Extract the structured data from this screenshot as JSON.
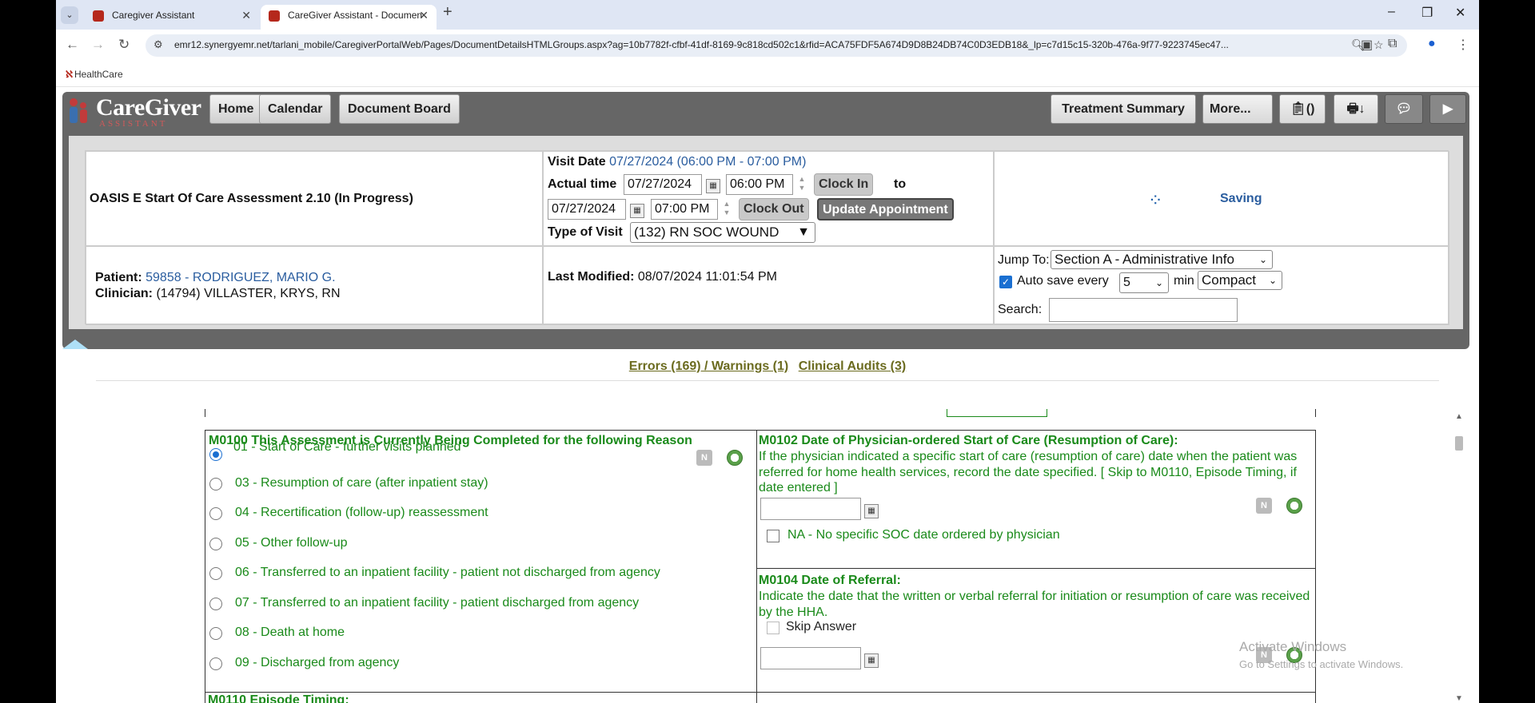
{
  "browser": {
    "tabs": [
      {
        "title": "Caregiver Assistant"
      },
      {
        "title": "CareGiver Assistant - Documen"
      }
    ],
    "url": "emr12.synergyemr.net/tarlani_mobile/CaregiverPortalWeb/Pages/DocumentDetailsHTMLGroups.aspx?ag=10b7782f-cfbf-41df-8169-9c818cd502c1&rfid=ACA75FDF5A674D9D8B24DB74C0D3EDB18&_lp=c7d15c15-320b-476a-9f77-9223745ec47...",
    "bookmark": "HealthCare"
  },
  "app": {
    "logo_main": "CareGiver",
    "logo_sub": "ASSISTANT",
    "nav": [
      "Home",
      "Calendar",
      "Document Board"
    ],
    "right_buttons": [
      "Treatment Summary",
      "More..."
    ],
    "clipboard_badge": "()"
  },
  "header": {
    "doc_title": "OASIS E Start Of Care Assessment 2.10 (In Progress)",
    "visit_date_label": "Visit Date",
    "visit_date_value": "07/27/2024 (06:00 PM - 07:00 PM)",
    "actual_time_label": "Actual time",
    "start_date": "07/27/2024",
    "start_time": "06:00 PM",
    "clock_in": "Clock In",
    "to_label": "to",
    "end_date": "07/27/2024",
    "end_time": "07:00 PM",
    "clock_out": "Clock Out",
    "update_appt": "Update Appointment",
    "type_label": "Type of Visit",
    "type_value": "(132) RN SOC WOUND",
    "saving": "Saving",
    "patient_label": "Patient:",
    "patient_value": "59858 - RODRIGUEZ, MARIO G.",
    "clinician_label": "Clinician:",
    "clinician_value": "(14794) VILLASTER, KRYS, RN",
    "last_mod_label": "Last Modified:",
    "last_mod_value": "08/07/2024 11:01:54 PM",
    "jump_label": "Jump To:",
    "jump_value": "Section A - Administrative Info",
    "autosave_label": "Auto save every",
    "autosave_value": "5",
    "min_label": "min",
    "view_value": "Compact",
    "search_label": "Search:"
  },
  "audits": {
    "errors": "Errors (169) / Warnings (1)",
    "clinical": "Clinical Audits (3)"
  },
  "form": {
    "m0100_title": "M0100 This Assessment is Currently Being Completed for the following Reason",
    "m0100_options": [
      "01 - Start of Care - further visits planned",
      "03 - Resumption of care (after inpatient stay)",
      "04 - Recertification (follow-up) reassessment",
      "05 - Other follow-up",
      "06 - Transferred to an inpatient facility - patient not discharged from agency",
      "07 - Transferred to an inpatient facility - patient discharged from agency",
      "08 - Death at home",
      "09 - Discharged from agency"
    ],
    "m0100_selected": 0,
    "m0102_title": "M0102 Date of Physician-ordered Start of Care (Resumption of Care):",
    "m0102_text": "If the physician indicated a specific start of care (resumption of care) date when the patient was referred for home health services, record the date specified. [ Skip to M0110, Episode Timing, if date entered ]",
    "m0102_na": "NA - No specific SOC date ordered by physician",
    "m0104_title": "M0104 Date of Referral:",
    "m0104_text": "Indicate the date that the written or verbal referral for initiation or resumption of care was received by the HHA.",
    "m0104_skip": "Skip Answer",
    "m0110_title": "M0110 Episode Timing:",
    "partial_date": "07/27/2024"
  },
  "watermark": {
    "line1": "Activate Windows",
    "line2": "Go to Settings to activate Windows."
  }
}
